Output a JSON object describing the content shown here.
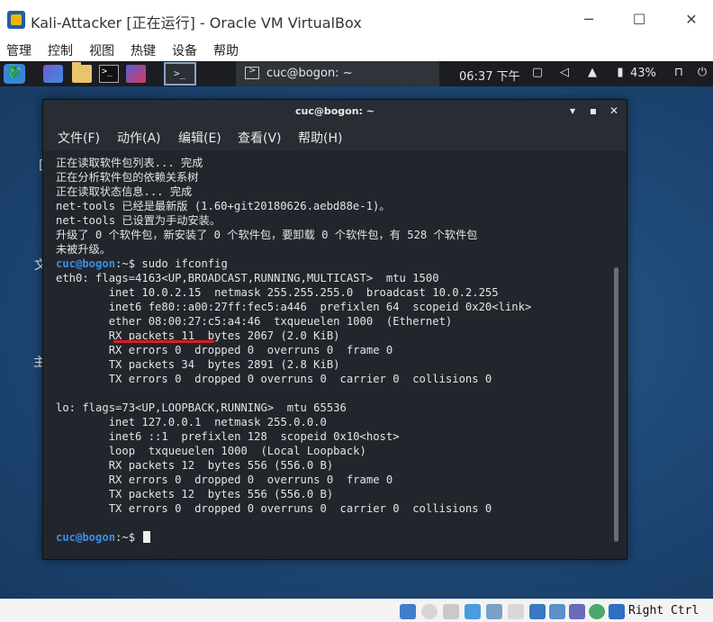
{
  "host_window": {
    "title": "Kali-Attacker [正在运行] - Oracle VM VirtualBox",
    "controls": {
      "minimize": "─",
      "maximize": "☐",
      "close": "✕"
    },
    "menu": [
      "管理",
      "控制",
      "视图",
      "热键",
      "设备",
      "帮助"
    ]
  },
  "guest": {
    "desktop_fragments": [
      "[",
      "文",
      "主文件夹"
    ],
    "panel": {
      "task_label": "cuc@bogon: ~",
      "clock": "06:37 下午",
      "battery": "43%"
    },
    "terminal": {
      "title": "cuc@bogon: ~",
      "controls": {
        "minimize": "▾",
        "maximize": "▪",
        "close": "✕"
      },
      "menu": [
        "文件(F)",
        "动作(A)",
        "编辑(E)",
        "查看(V)",
        "帮助(H)"
      ],
      "output_lines": [
        {
          "text": "正在读取软件包列表... 完成"
        },
        {
          "text": "正在分析软件包的依赖关系树"
        },
        {
          "text": "正在读取状态信息... 完成"
        },
        {
          "text": "net-tools 已经是最新版 (1.60+git20180626.aebd88e-1)。"
        },
        {
          "text": "net-tools 已设置为手动安装。"
        },
        {
          "text": "升级了 0 个软件包，新安装了 0 个软件包，要卸载 0 个软件包，有 528 个软件包"
        },
        {
          "text": "未被升级。"
        },
        {
          "prompt": "cuc@bogon",
          "suffix": ":~$ ",
          "command": "sudo ifconfig"
        },
        {
          "text": "eth0: flags=4163<UP,BROADCAST,RUNNING,MULTICAST>  mtu 1500"
        },
        {
          "text": "        inet 10.0.2.15  netmask 255.255.255.0  broadcast 10.0.2.255"
        },
        {
          "text": "        inet6 fe80::a00:27ff:fec5:a446  prefixlen 64  scopeid 0x20<link>"
        },
        {
          "text": "        ether 08:00:27:c5:a4:46  txqueuelen 1000  (Ethernet)"
        },
        {
          "text": "        RX packets 11  bytes 2067 (2.0 KiB)"
        },
        {
          "text": "        RX errors 0  dropped 0  overruns 0  frame 0"
        },
        {
          "text": "        TX packets 34  bytes 2891 (2.8 KiB)"
        },
        {
          "text": "        TX errors 0  dropped 0 overruns 0  carrier 0  collisions 0"
        },
        {
          "text": ""
        },
        {
          "text": "lo: flags=73<UP,LOOPBACK,RUNNING>  mtu 65536"
        },
        {
          "text": "        inet 127.0.0.1  netmask 255.0.0.0"
        },
        {
          "text": "        inet6 ::1  prefixlen 128  scopeid 0x10<host>"
        },
        {
          "text": "        loop  txqueuelen 1000  (Local Loopback)"
        },
        {
          "text": "        RX packets 12  bytes 556 (556.0 B)"
        },
        {
          "text": "        RX errors 0  dropped 0  overruns 0  frame 0"
        },
        {
          "text": "        TX packets 12  bytes 556 (556.0 B)"
        },
        {
          "text": "        TX errors 0  dropped 0 overruns 0  carrier 0  collisions 0"
        },
        {
          "text": ""
        },
        {
          "prompt": "cuc@bogon",
          "suffix": ":~$ ",
          "command": "",
          "cursor": true
        }
      ]
    }
  },
  "statusbar": {
    "host_key": "Right Ctrl",
    "icon_names": [
      "hard-disk-icon",
      "optical-drive-icon",
      "audio-icon",
      "network-icon",
      "usb-icon",
      "shared-folder-icon",
      "display-icon",
      "recording-icon",
      "cpu-icon",
      "mouse-integration-icon",
      "keyboard-capture-icon"
    ]
  },
  "colors": {
    "prompt": "#3d8fe0",
    "terminal_bg": "#22262c",
    "annotation_underline": "#d81e1e"
  }
}
